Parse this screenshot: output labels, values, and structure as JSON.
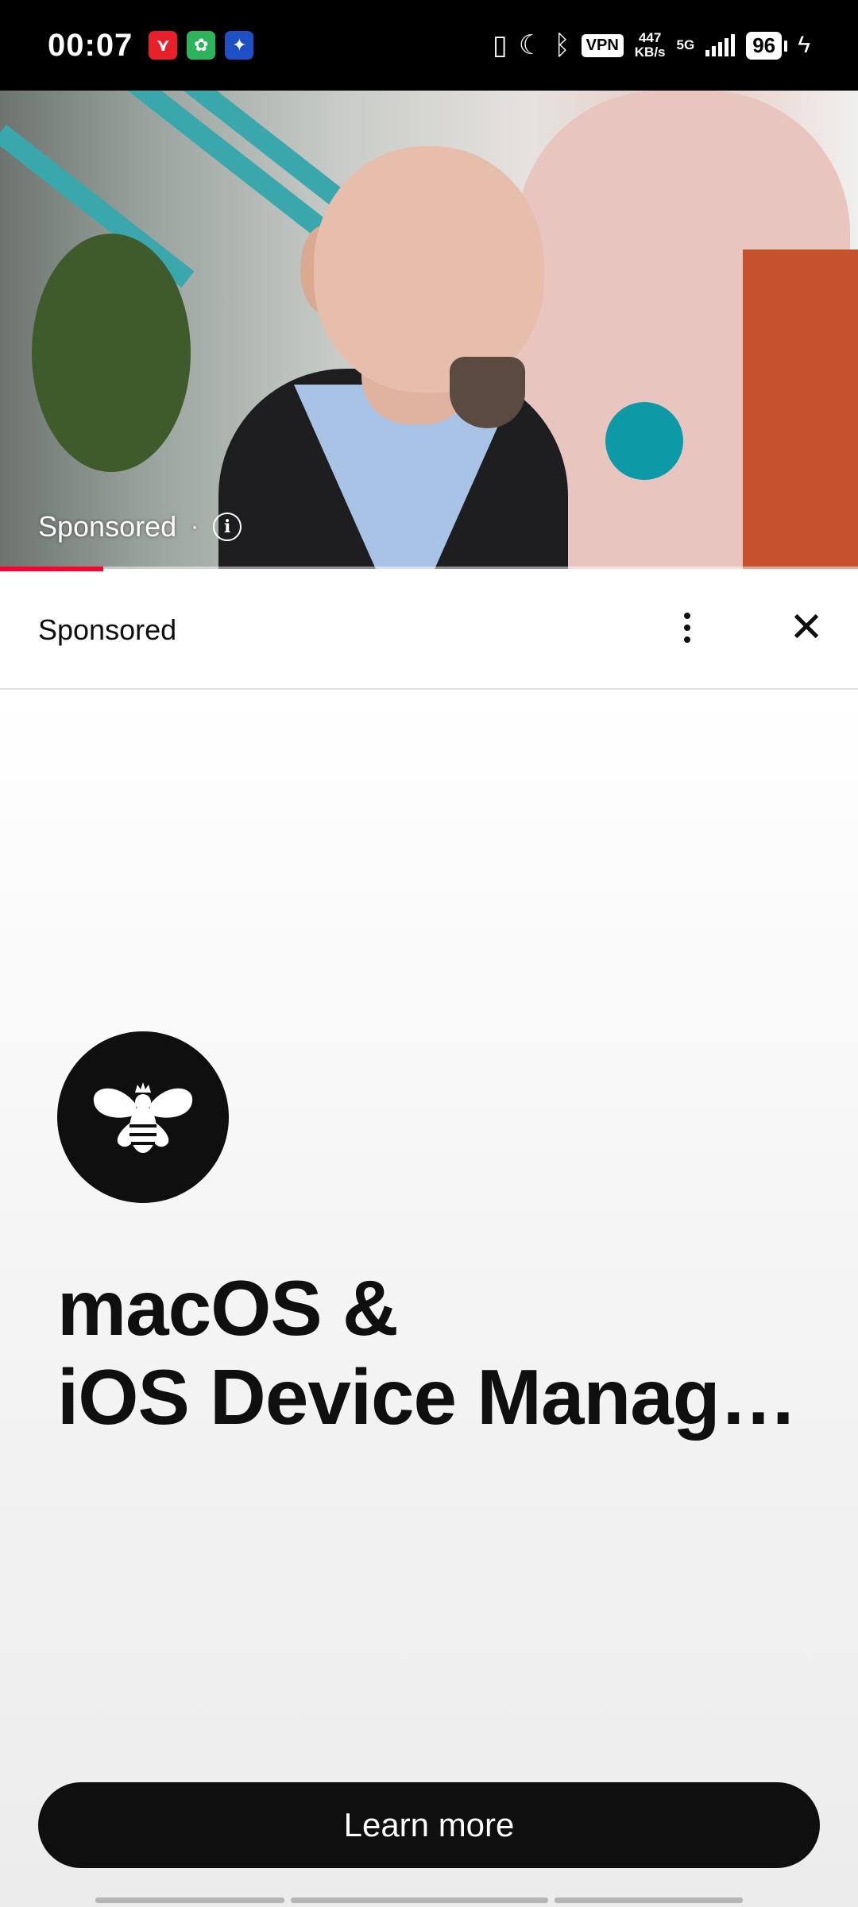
{
  "status_bar": {
    "time": "00:07",
    "notification_icons": [
      {
        "name": "app-notification-red",
        "color": "#e8202a",
        "glyph": "⋎"
      },
      {
        "name": "app-notification-green",
        "color": "#2db45a",
        "glyph": "✿"
      },
      {
        "name": "app-notification-blue",
        "color": "#1f4fc4",
        "glyph": "✦"
      }
    ],
    "vpn": "VPN",
    "speed_value": "447",
    "speed_unit": "KB/s",
    "network": "5G",
    "battery": "96"
  },
  "video": {
    "sponsored_label": "Sponsored",
    "separator": "·",
    "info_glyph": "i",
    "progress": 0.12,
    "progress_color": "#ff0033"
  },
  "ad_header": {
    "label": "Sponsored",
    "close_glyph": "✕"
  },
  "ad": {
    "headline_line1": "macOS &",
    "headline_line2": "iOS Device Management",
    "cta_label": "Learn more"
  },
  "page_indicators": [
    0.22,
    0.3,
    0.22
  ]
}
